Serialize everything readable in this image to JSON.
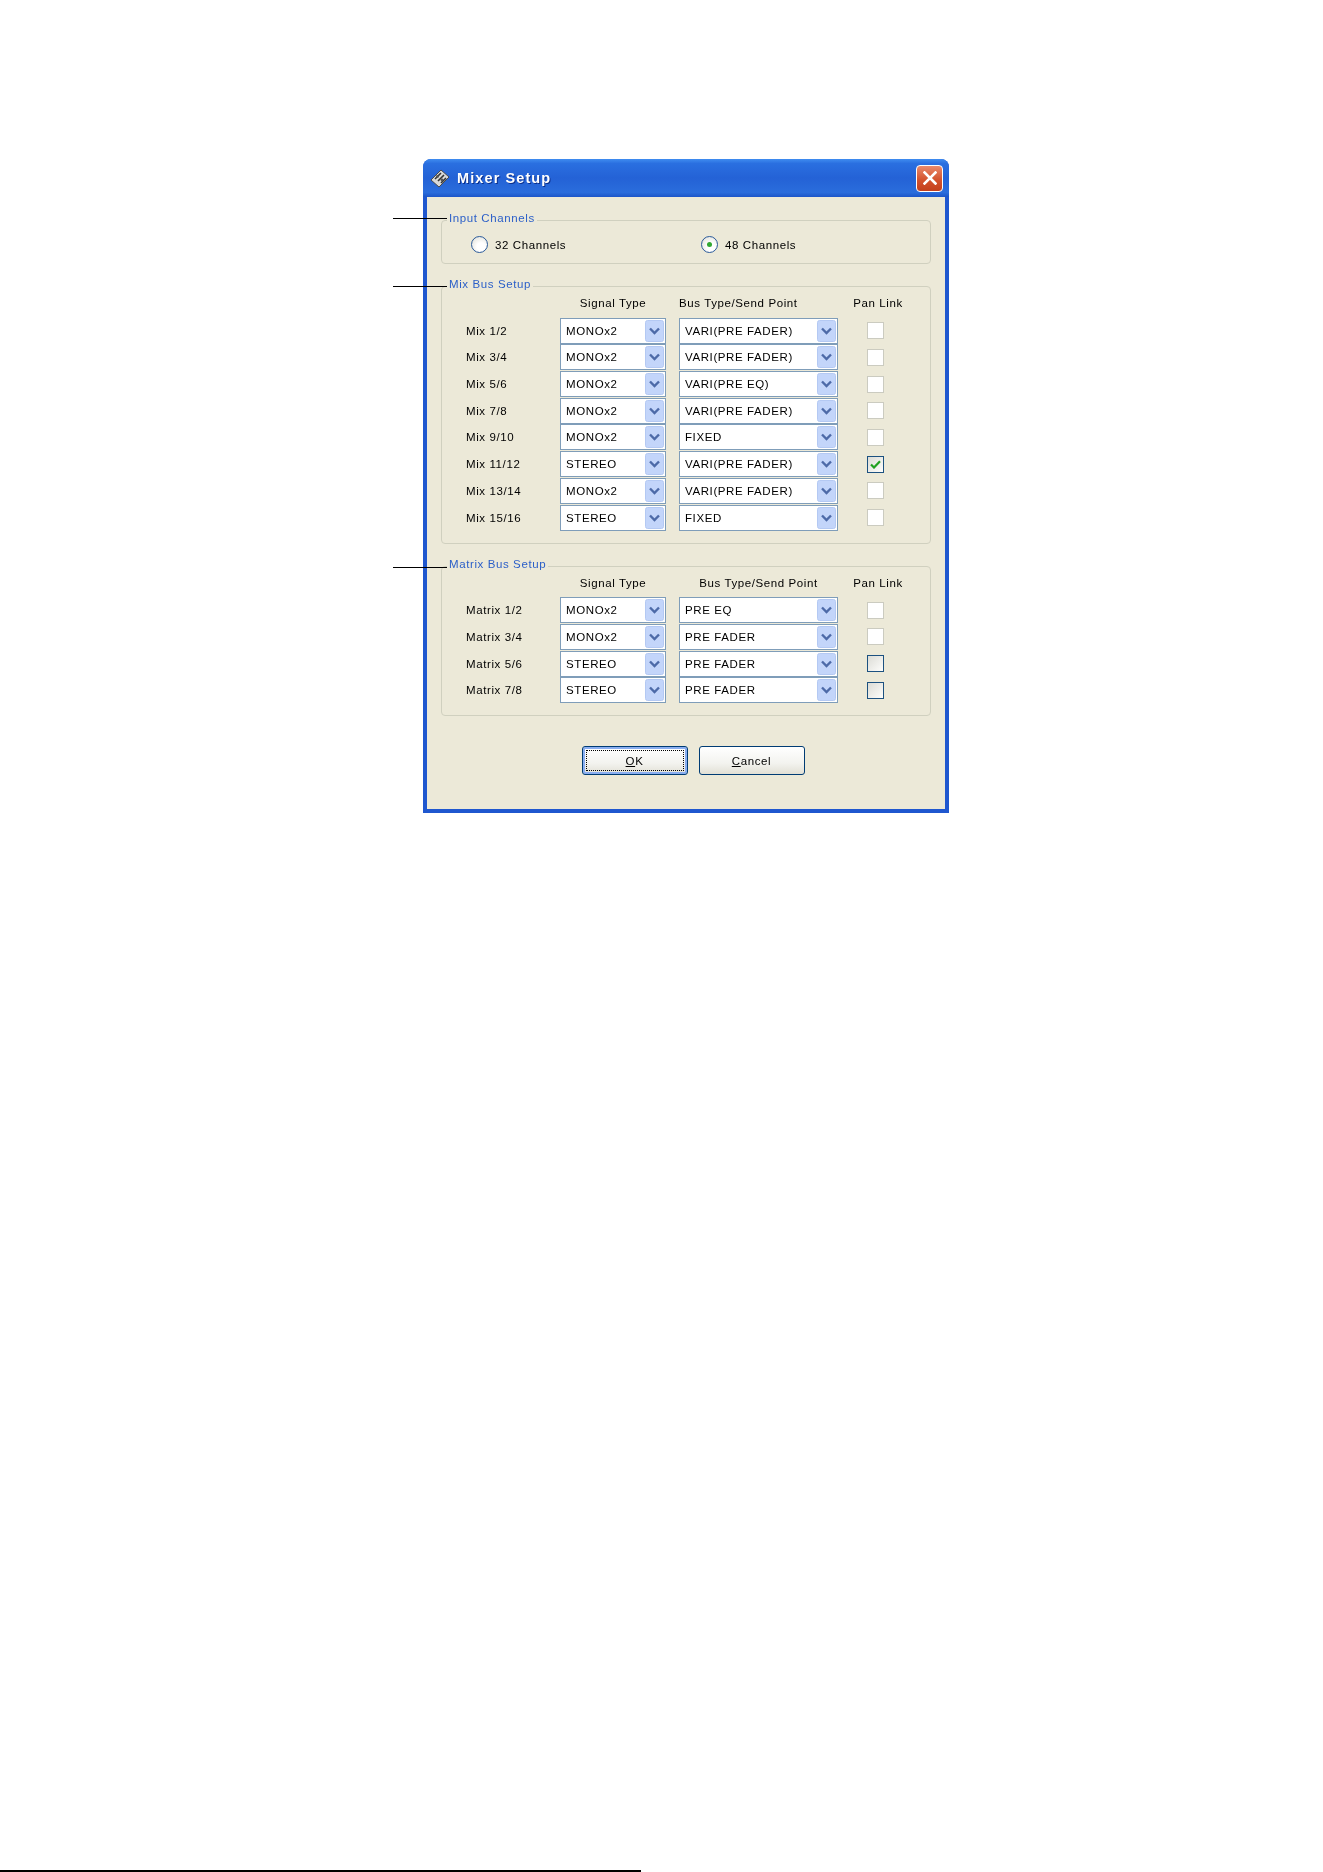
{
  "window": {
    "title": "Mixer Setup"
  },
  "input_channels": {
    "title": "Input Channels",
    "options": [
      {
        "label": "32 Channels",
        "selected": false
      },
      {
        "label": "48 Channels",
        "selected": true
      }
    ]
  },
  "mix_bus_setup": {
    "title": "Mix Bus Setup",
    "columns": [
      "Signal Type",
      "Bus Type/Send Point",
      "Pan Link"
    ],
    "rows": [
      {
        "name": "Mix 1/2",
        "signal_type": "MONOx2",
        "bus_type": "VARI(PRE FADER)",
        "pan_link": {
          "checked": false,
          "disabled": true
        }
      },
      {
        "name": "Mix 3/4",
        "signal_type": "MONOx2",
        "bus_type": "VARI(PRE FADER)",
        "pan_link": {
          "checked": false,
          "disabled": true
        }
      },
      {
        "name": "Mix 5/6",
        "signal_type": "MONOx2",
        "bus_type": "VARI(PRE EQ)",
        "pan_link": {
          "checked": false,
          "disabled": true
        }
      },
      {
        "name": "Mix 7/8",
        "signal_type": "MONOx2",
        "bus_type": "VARI(PRE FADER)",
        "pan_link": {
          "checked": false,
          "disabled": true
        }
      },
      {
        "name": "Mix 9/10",
        "signal_type": "MONOx2",
        "bus_type": "FIXED",
        "pan_link": {
          "checked": false,
          "disabled": true
        }
      },
      {
        "name": "Mix 11/12",
        "signal_type": "STEREO",
        "bus_type": "VARI(PRE FADER)",
        "pan_link": {
          "checked": true,
          "disabled": false
        }
      },
      {
        "name": "Mix 13/14",
        "signal_type": "MONOx2",
        "bus_type": "VARI(PRE FADER)",
        "pan_link": {
          "checked": false,
          "disabled": true
        }
      },
      {
        "name": "Mix 15/16",
        "signal_type": "STEREO",
        "bus_type": "FIXED",
        "pan_link": {
          "checked": false,
          "disabled": true
        }
      }
    ]
  },
  "matrix_bus_setup": {
    "title": "Matrix Bus Setup",
    "columns": [
      "Signal Type",
      "Bus Type/Send Point",
      "Pan Link"
    ],
    "rows": [
      {
        "name": "Matrix 1/2",
        "signal_type": "MONOx2",
        "bus_type": "PRE EQ",
        "pan_link": {
          "checked": false,
          "disabled": true
        }
      },
      {
        "name": "Matrix 3/4",
        "signal_type": "MONOx2",
        "bus_type": "PRE FADER",
        "pan_link": {
          "checked": false,
          "disabled": true
        }
      },
      {
        "name": "Matrix 5/6",
        "signal_type": "STEREO",
        "bus_type": "PRE FADER",
        "pan_link": {
          "checked": false,
          "disabled": false
        }
      },
      {
        "name": "Matrix 7/8",
        "signal_type": "STEREO",
        "bus_type": "PRE FADER",
        "pan_link": {
          "checked": false,
          "disabled": false
        }
      }
    ]
  },
  "buttons": [
    {
      "label": "OK",
      "focused": true
    },
    {
      "label": "Cancel",
      "focused": false
    }
  ]
}
